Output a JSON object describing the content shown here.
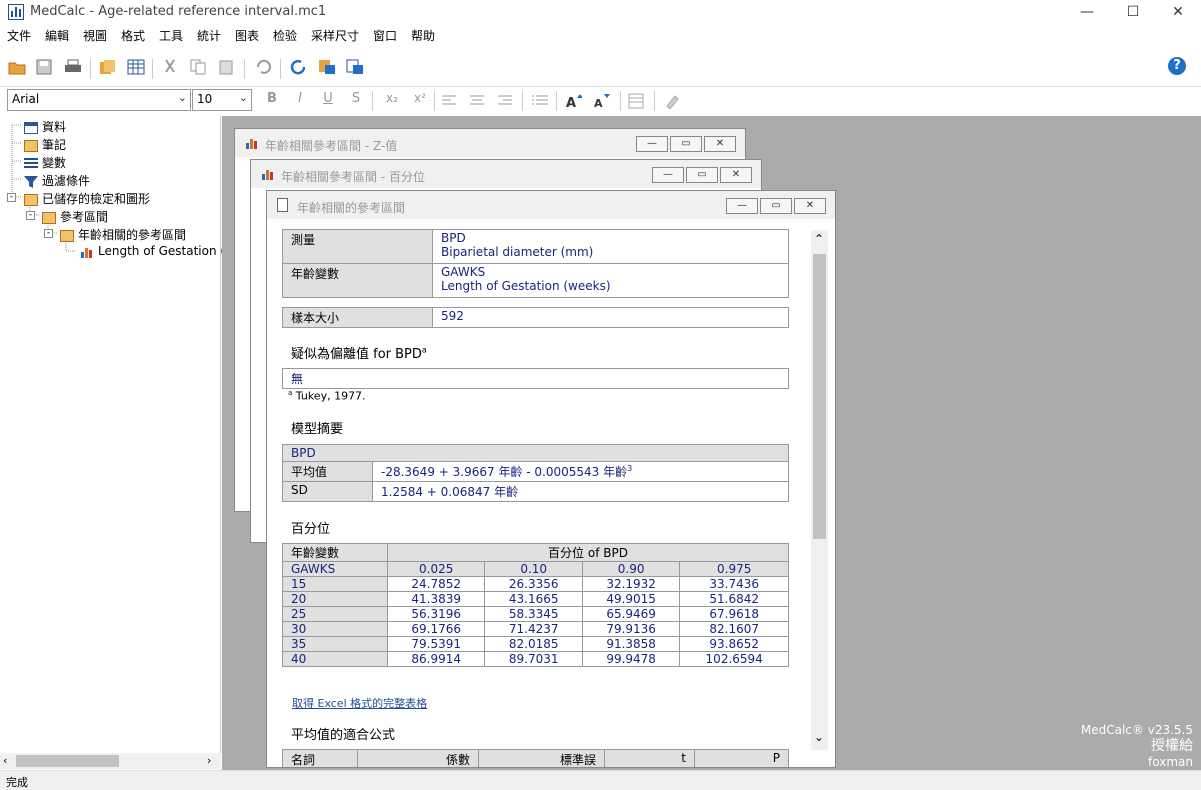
{
  "window": {
    "title": "MedCalc - Age-related reference interval.mc1",
    "minimize": "—",
    "maximize": "☐",
    "close": "✕"
  },
  "menu": [
    "文件",
    "編輯",
    "視圖",
    "格式",
    "工具",
    "統计",
    "图表",
    "检验",
    "采样尺寸",
    "窗口",
    "帮助"
  ],
  "toolbar2": {
    "font": "Arial",
    "size": "10",
    "bold": "B",
    "italic": "I",
    "underline": "U",
    "strike": "S",
    "sub": "x₂",
    "sup": "x²"
  },
  "tree": {
    "items": [
      "資料",
      "筆記",
      "變數",
      "過濾條件",
      "已儲存的檢定和圖形",
      "參考區間",
      "年齡相關的參考區間",
      "Length of Gestation (w"
    ]
  },
  "windows": {
    "w1": "年齡相關參考區間 - Z-值",
    "w2": "年齡相關參考區間 - 百分位",
    "w3": "年齡相關的參考區間"
  },
  "report": {
    "measure_label": "測量",
    "measure_value": "BPD",
    "measure_desc": "Biparietal diameter (mm)",
    "agevar_label": "年齡變數",
    "agevar_value": "GAWKS",
    "agevar_desc": "Length of Gestation (weeks)",
    "n_label": "樣本大小",
    "n_value": "592",
    "outlier_heading": "疑似為偏離值 for BPD",
    "outlier_sup": "a",
    "outlier_value": "無",
    "footnote_mark": "a",
    "footnote": "Tukey, 1977.",
    "model_heading": "模型摘要",
    "model_var": "BPD",
    "mean_label": "平均值",
    "mean_formula": "-28.3649 + 3.9667 年齡 - 0.0005543 年齡",
    "mean_sup": "3",
    "sd_label": "SD",
    "sd_formula": "1.2584 + 0.06847 年齡",
    "pct_heading": "百分位",
    "pct_agevar": "年齡變數",
    "pct_header": "百分位 of BPD",
    "pct_var": "GAWKS",
    "pct_cols": [
      "0.025",
      "0.10",
      "0.90",
      "0.975"
    ],
    "pct_rows": [
      [
        "15",
        "24.7852",
        "26.3356",
        "32.1932",
        "33.7436"
      ],
      [
        "20",
        "41.3839",
        "43.1665",
        "49.9015",
        "51.6842"
      ],
      [
        "25",
        "56.3196",
        "58.3345",
        "65.9469",
        "67.9618"
      ],
      [
        "30",
        "69.1766",
        "71.4237",
        "79.9136",
        "82.1607"
      ],
      [
        "35",
        "79.5391",
        "82.0185",
        "91.3858",
        "93.8652"
      ],
      [
        "40",
        "86.9914",
        "89.7031",
        "99.9478",
        "102.6594"
      ]
    ],
    "excel_link": "取得 Excel 格式的完整表格",
    "fit_heading": "平均值的適合公式",
    "fit_cols": [
      "名詞",
      "係數",
      "標準誤",
      "t",
      "P"
    ]
  },
  "watermark": {
    "line1": "MedCalc® v23.5.5",
    "line2": "授權給",
    "line3": "foxman"
  },
  "status": "完成",
  "help": "?"
}
